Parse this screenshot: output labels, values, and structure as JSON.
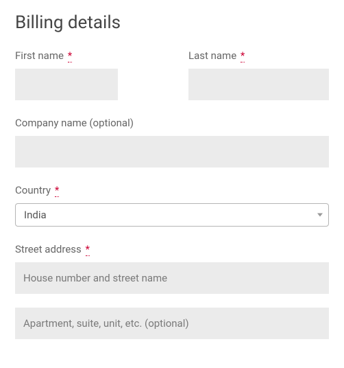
{
  "heading": "Billing details",
  "fields": {
    "first_name": {
      "label": "First name",
      "required": true,
      "value": ""
    },
    "last_name": {
      "label": "Last name",
      "required": true,
      "value": ""
    },
    "company": {
      "label": "Company name (optional)",
      "required": false,
      "value": ""
    },
    "country": {
      "label": "Country",
      "required": true,
      "value": "India"
    },
    "street": {
      "label": "Street address",
      "required": true,
      "placeholder1": "House number and street name",
      "placeholder2": "Apartment, suite, unit, etc. (optional)",
      "value1": "",
      "value2": ""
    }
  },
  "required_marker": "*"
}
